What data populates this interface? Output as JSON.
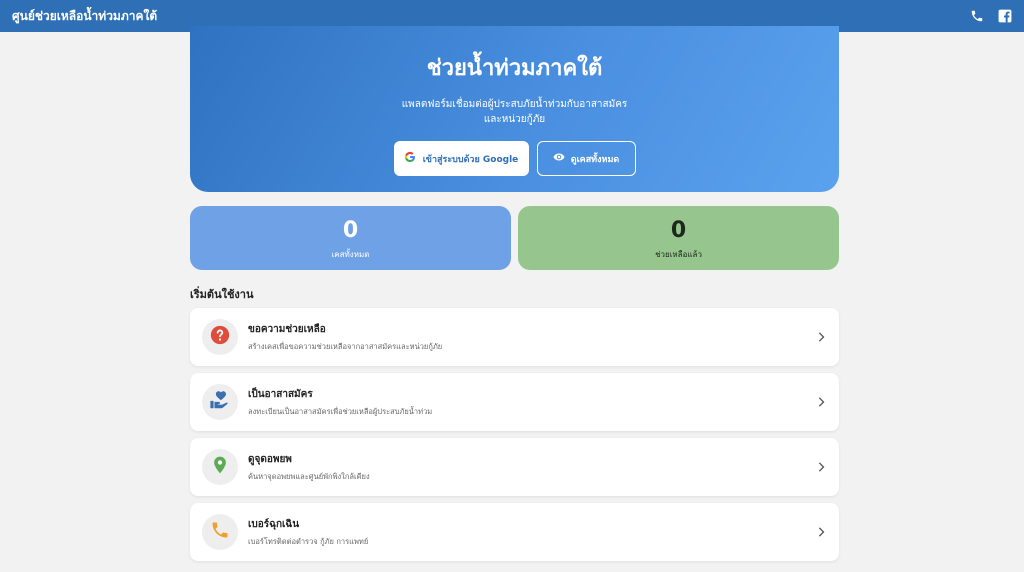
{
  "header": {
    "title": "ศูนย์ช่วยเหลือน้ำท่วมภาคใต้",
    "icons": [
      "phone-icon",
      "facebook-icon"
    ]
  },
  "hero": {
    "title": "ช่วยน้ำท่วมภาคใต้",
    "subtitle_line1": "แพลตฟอร์มเชื่อมต่อผู้ประสบภัยน้ำท่วมกับอาสาสมัคร",
    "subtitle_line2": "และหน่วยกู้ภัย",
    "login_button": "เข้าสู่ระบบด้วย Google",
    "view_cases_button": "ดูเคสทั้งหมด"
  },
  "stats": {
    "total_value": "0",
    "total_label": "เคสทั้งหมด",
    "helped_value": "0",
    "helped_label": "ช่วยเหลือแล้ว"
  },
  "section_title": "เริ่มต้นใช้งาน",
  "menu": [
    {
      "title": "ขอความช่วยเหลือ",
      "desc": "สร้างเคสเพื่อขอความช่วยเหลือจากอาสาสมัครและหน่วยกู้ภัย",
      "icon": "help-icon"
    },
    {
      "title": "เป็นอาสาสมัคร",
      "desc": "ลงทะเบียนเป็นอาสาสมัครเพื่อช่วยเหลือผู้ประสบภัยน้ำท่วม",
      "icon": "volunteer-icon"
    },
    {
      "title": "ดูจุดอพยพ",
      "desc": "ค้นหาจุดอพยพและศูนย์พักพิงใกล้เคียง",
      "icon": "location-pin-icon"
    },
    {
      "title": "เบอร์ฉุกเฉิน",
      "desc": "เบอร์โทรติดต่อตำรวจ กู้ภัย การแพทย์",
      "icon": "phone-icon"
    }
  ],
  "colors": {
    "header": "#2f6fb5",
    "hero_start": "#2f72c1",
    "hero_end": "#5aa2ee",
    "stat_total": "#6ea1e6",
    "stat_helped": "#96c68d",
    "help_icon": "#e04c3c",
    "volunteer_icon": "#3a6fb0",
    "location_icon": "#5cab54",
    "phone_icon": "#f0a030"
  }
}
